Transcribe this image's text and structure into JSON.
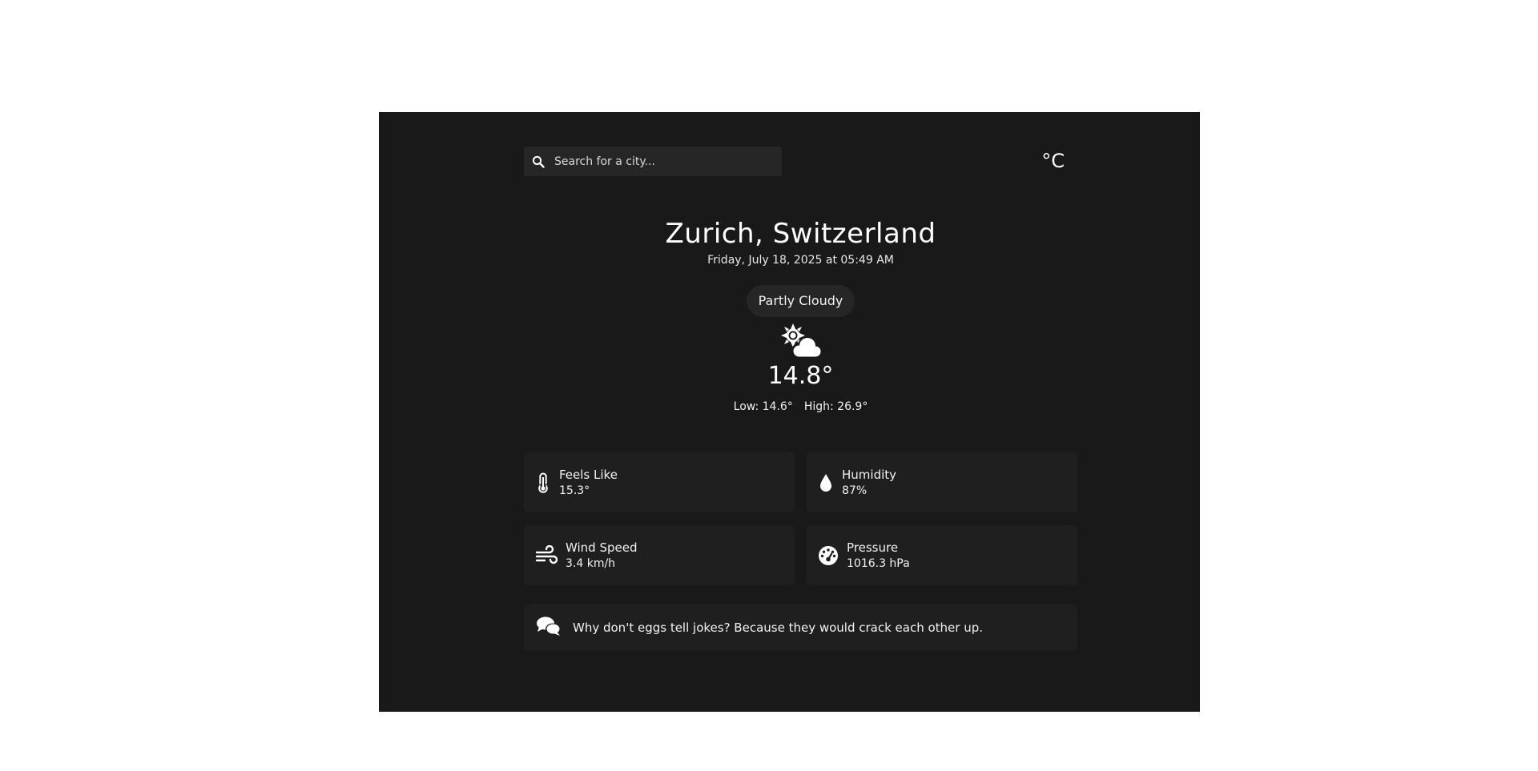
{
  "search": {
    "placeholder": "Search for a city...",
    "value": ""
  },
  "unit_toggle": "°C",
  "location": "Zurich, Switzerland",
  "datetime": "Friday, July 18, 2025 at 05:49 AM",
  "condition": "Partly Cloudy",
  "condition_icon": "partly-cloudy-icon",
  "temperature": "14.8°",
  "low": "Low: 14.6°",
  "high": "High: 26.9°",
  "details": [
    {
      "label": "Feels Like",
      "value": "15.3°",
      "icon": "thermometer-icon"
    },
    {
      "label": "Humidity",
      "value": "87%",
      "icon": "droplet-icon"
    },
    {
      "label": "Wind Speed",
      "value": "3.4 km/h",
      "icon": "wind-icon"
    },
    {
      "label": "Pressure",
      "value": "1016.3 hPa",
      "icon": "gauge-icon"
    }
  ],
  "joke": {
    "icon": "chat-bubbles-icon",
    "text": "Why don't eggs tell jokes? Because they would crack each other up."
  },
  "colors": {
    "panel_background": "#191919",
    "card_background": "#1f1f1f",
    "search_background": "#262626",
    "text": "#ffffff"
  }
}
